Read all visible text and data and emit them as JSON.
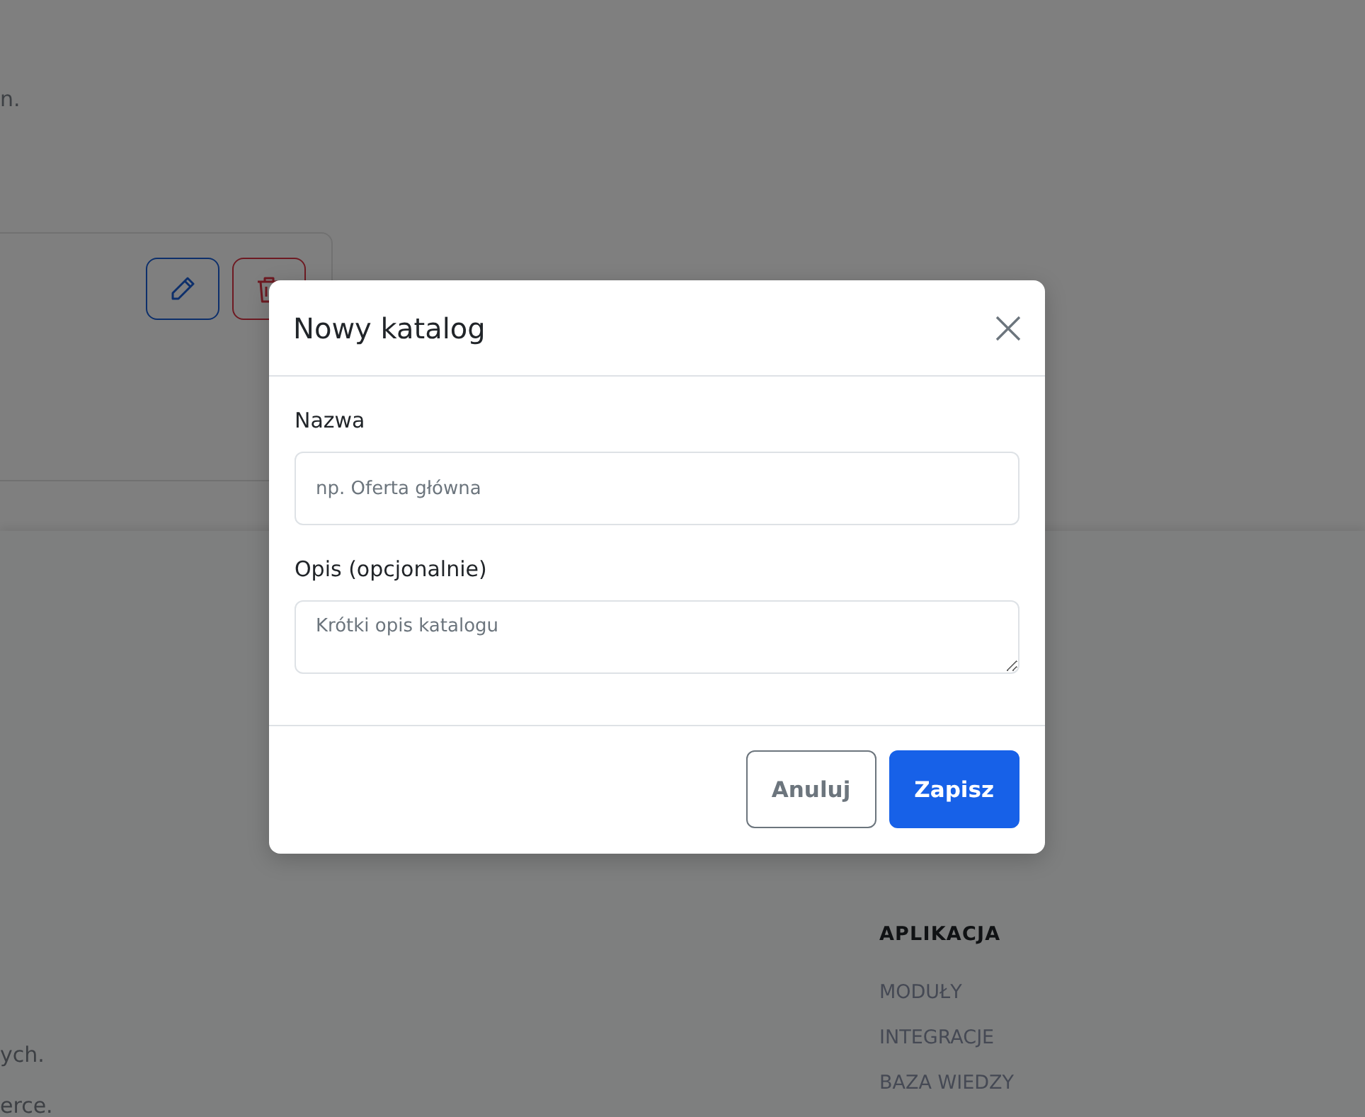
{
  "page": {
    "intro_text": "n.",
    "card": {
      "actions": [
        {
          "kind": "edit"
        },
        {
          "kind": "delete"
        }
      ]
    },
    "footer": {
      "texts": [
        "ych.",
        "erce."
      ],
      "column": {
        "heading": "APLIKACJA",
        "links": [
          "MODUŁY",
          "INTEGRACJE",
          "BAZA WIEDZY"
        ]
      }
    }
  },
  "modal": {
    "title": "Nowy katalog",
    "fields": [
      {
        "kind": "input",
        "label": "Nazwa",
        "placeholder": "np. Oferta główna"
      },
      {
        "kind": "textarea",
        "label": "Opis (opcjonalnie)",
        "placeholder": "Krótki opis katalogu"
      }
    ],
    "buttons": [
      {
        "kind": "secondary",
        "label": "Anuluj"
      },
      {
        "kind": "primary",
        "label": "Zapisz"
      }
    ]
  }
}
